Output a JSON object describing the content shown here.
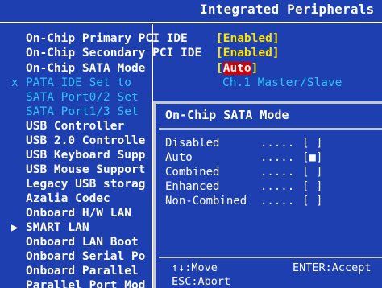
{
  "header": {
    "title": "Integrated Peripherals"
  },
  "menu": {
    "items": [
      {
        "marker": "",
        "label": "On-Chip Primary   PCI IDE",
        "value": "[Enabled]",
        "disabled": false
      },
      {
        "marker": "",
        "label": "On-Chip Secondary PCI IDE",
        "value": "[Enabled]",
        "disabled": false
      },
      {
        "marker": "",
        "label": "On-Chip SATA Mode",
        "value": "[Auto]",
        "value_open": "[",
        "value_hl": "Auto",
        "value_close": "]",
        "disabled": false
      },
      {
        "marker": "x",
        "label": "PATA IDE Set to",
        "value": "Ch.1 Master/Slave",
        "disabled": true
      },
      {
        "marker": "",
        "label": "SATA Port0/2 Set",
        "value": "",
        "disabled": true
      },
      {
        "marker": "",
        "label": "SATA Port1/3 Set",
        "value": "",
        "disabled": true
      },
      {
        "marker": "",
        "label": "USB Controller",
        "value": "",
        "disabled": false
      },
      {
        "marker": "",
        "label": "USB 2.0 Controlle",
        "value": "",
        "disabled": false
      },
      {
        "marker": "",
        "label": "USB Keyboard Supp",
        "value": "",
        "disabled": false
      },
      {
        "marker": "",
        "label": "USB Mouse Support",
        "value": "",
        "disabled": false
      },
      {
        "marker": "",
        "label": "Legacy USB storag",
        "value": "",
        "disabled": false
      },
      {
        "marker": "",
        "label": "Azalia Codec",
        "value": "",
        "disabled": false
      },
      {
        "marker": "",
        "label": "Onboard H/W LAN",
        "value": "",
        "disabled": false
      },
      {
        "marker": "▶",
        "label": "SMART LAN",
        "value": "",
        "disabled": false
      },
      {
        "marker": "",
        "label": "Onboard LAN Boot",
        "value": "",
        "disabled": false
      },
      {
        "marker": "",
        "label": "Onboard Serial Po",
        "value": "",
        "disabled": false
      },
      {
        "marker": "",
        "label": "Onboard Parallel",
        "value": "",
        "disabled": false
      },
      {
        "marker": "",
        "label": "Parallel Port Mod",
        "value": "",
        "disabled": false
      }
    ]
  },
  "popup": {
    "title": "On-Chip SATA Mode",
    "options": [
      {
        "label": "Disabled",
        "dots": ".....",
        "mark": "[ ]"
      },
      {
        "label": "Auto",
        "dots": ".....",
        "mark": "[■]"
      },
      {
        "label": "Combined",
        "dots": ".....",
        "mark": "[ ]"
      },
      {
        "label": "Enhanced",
        "dots": ".....",
        "mark": "[ ]"
      },
      {
        "label": "Non-Combined",
        "dots": ".....",
        "mark": "[ ]"
      }
    ],
    "help": {
      "move": "↑↓:Move",
      "accept": "ENTER:Accept",
      "abort": "ESC:Abort"
    }
  },
  "colors": {
    "background": "#1e3fb0",
    "value_text": "#ffe400",
    "highlight": "#d40000",
    "disabled_text": "#2ec3ff"
  }
}
